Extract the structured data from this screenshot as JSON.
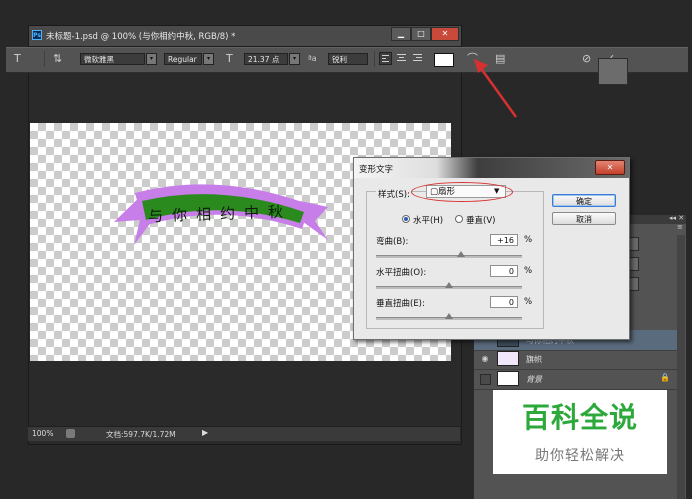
{
  "document": {
    "title": "未标题-1.psd @ 100% (与你相约中秋, RGB/8) *",
    "app_badge": "Ps",
    "min_symbol": "▁",
    "max_symbol": "□",
    "close_symbol": "✕"
  },
  "options_bar": {
    "tool_symbol": "T",
    "orient_symbol": "⇅",
    "font_family": "微软雅黑",
    "font_style": "Regular",
    "size_symbol": "T",
    "font_size": "21.37 点",
    "aa_symbol": "ªa",
    "antialias": "锐利",
    "text_color": "#ffffff",
    "warp_symbol": "⌒",
    "panel_symbol": "▤",
    "cancel_symbol": "⊘",
    "commit_symbol": "✓"
  },
  "canvas": {
    "ribbon_text": "与你相约中秋",
    "ribbon_color": "#c77ee8",
    "band_color": "#2b8a1e"
  },
  "status_bar": {
    "zoom": "100%",
    "doc_info": "文档:597.7K/1.72M",
    "arrow": "▶"
  },
  "warp_dialog": {
    "title": "变形文字",
    "close_symbol": "✕",
    "style_label": "样式(S):",
    "style_value": "▢扇形",
    "style_arrow": "▼",
    "horizontal_label": "水平(H)",
    "vertical_label": "垂直(V)",
    "horizontal_selected": true,
    "bend_label": "弯曲(B):",
    "bend_value": "+16",
    "h_distortion_label": "水平扭曲(O):",
    "h_distortion_value": "0",
    "v_distortion_label": "垂直扭曲(E):",
    "v_distortion_value": "0",
    "percent": "%",
    "ok_label": "确定",
    "cancel_label": "取消",
    "bend_percent": 16,
    "h_distortion_percent": 0,
    "v_distortion_percent": 0
  },
  "layers_panel": {
    "collapse_symbol": "◂◂ ✕",
    "menu_symbol": "≡",
    "layers": [
      {
        "name": "与你相约中秋",
        "type": "text",
        "selected": true
      },
      {
        "name": "旗帜",
        "visible": true
      },
      {
        "name": "背景",
        "locked": true
      }
    ],
    "eye_symbol": "◉",
    "lock_symbol": "🔒"
  },
  "watermark": {
    "title": "百科全说",
    "subtitle": "助你轻松解决"
  },
  "colors": {
    "annotation_red": "#d83030",
    "dialog_bg": "#e9e9e9"
  }
}
